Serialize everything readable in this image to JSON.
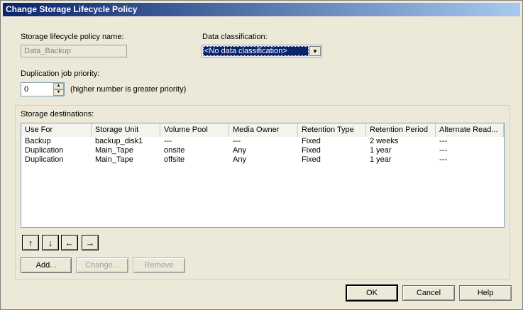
{
  "window": {
    "title": "Change Storage Lifecycle Policy"
  },
  "policy_name": {
    "label": "Storage lifecycle policy name:",
    "value": "Data_Backup"
  },
  "data_classification": {
    "label": "Data classification:",
    "selected": "<No data classification>"
  },
  "priority": {
    "label": "Duplication job priority:",
    "value": "0",
    "hint": "(higher number is greater priority)"
  },
  "destinations": {
    "label": "Storage destinations:",
    "columns": [
      "Use For",
      "Storage Unit",
      "Volume Pool",
      "Media Owner",
      "Retention Type",
      "Retention Period",
      "Alternate Read..."
    ],
    "rows": [
      [
        "Backup",
        "backup_disk1",
        "---",
        "---",
        "Fixed",
        "2 weeks",
        "---"
      ],
      [
        "Duplication",
        "Main_Tape",
        "onsite",
        "Any",
        "Fixed",
        "1 year",
        "---"
      ],
      [
        "Duplication",
        "Main_Tape",
        "offsite",
        "Any",
        "Fixed",
        "1 year",
        "---"
      ]
    ]
  },
  "move_buttons": {
    "up": "↑",
    "down": "↓",
    "left": "←",
    "right": "→"
  },
  "actions": {
    "add": "Add. .",
    "change": "Change...",
    "remove": "Remove"
  },
  "dialog_buttons": {
    "ok": "OK",
    "cancel": "Cancel",
    "help": "Help"
  }
}
